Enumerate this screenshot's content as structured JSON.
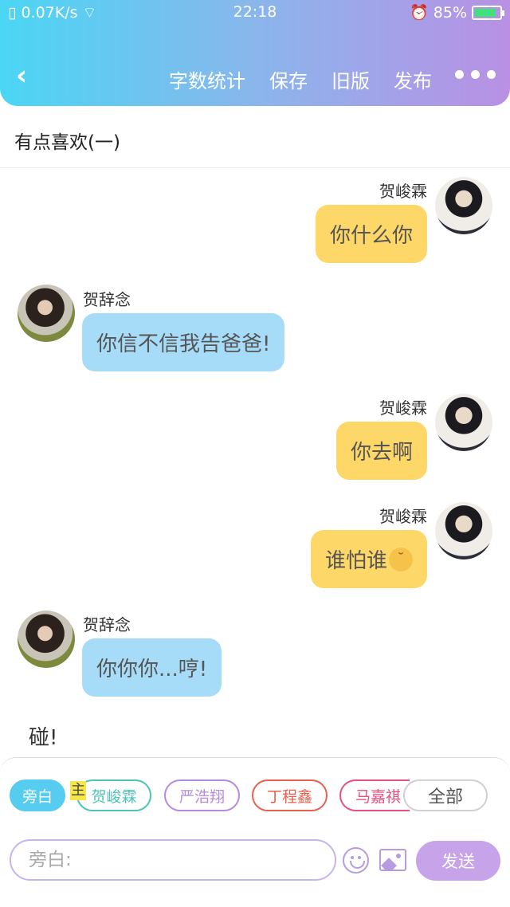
{
  "status_bar": {
    "speed": "0.07K/s",
    "time": "22:18",
    "battery": "85%",
    "battery_level": 0.85
  },
  "header": {
    "back_label": "‹",
    "actions": [
      "字数统计",
      "保存",
      "旧版",
      "发布"
    ],
    "more_icon": "more-dots-icon"
  },
  "story": {
    "title": "有点喜欢(一)"
  },
  "messages": [
    {
      "speaker": "贺峻霖",
      "text": "你什么你",
      "side": "right",
      "color": "#fdd868"
    },
    {
      "speaker": "贺辞念",
      "text": "你信不信我告爸爸!",
      "side": "left",
      "color": "#a6dcf8"
    },
    {
      "speaker": "贺峻霖",
      "text": "你去啊",
      "side": "right",
      "color": "#fdd868"
    },
    {
      "speaker": "贺峻霖",
      "text": "谁怕谁",
      "emoji": "unamused-face-icon",
      "side": "right",
      "color": "#fdd868"
    },
    {
      "speaker": "贺辞念",
      "text": "你你你...哼!",
      "side": "left",
      "color": "#a6dcf8"
    }
  ],
  "narration": "碰!",
  "roles": {
    "main_mark": "主",
    "chips": [
      {
        "label": "旁白",
        "color": "#55ccf0"
      },
      {
        "label": "贺峻霖",
        "color": "#4cc4b6"
      },
      {
        "label": "严浩翔",
        "color": "#b58be0"
      },
      {
        "label": "丁程鑫",
        "color": "#e8604e"
      },
      {
        "label": "马嘉祺",
        "color": "#e8507e"
      },
      {
        "label": "全部",
        "color": "#d0d0d0"
      }
    ]
  },
  "composer": {
    "placeholder": "旁白:",
    "send_label": "发送",
    "emoji_icon": "smiley-icon",
    "image_icon": "image-icon"
  }
}
